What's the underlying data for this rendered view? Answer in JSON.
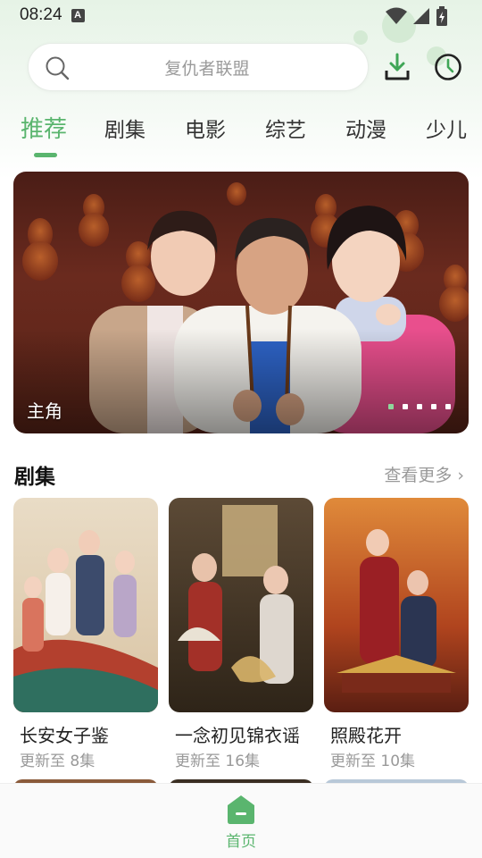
{
  "status_bar": {
    "time": "08:24",
    "notif_badge": "A"
  },
  "search": {
    "placeholder": "复仇者联盟"
  },
  "tabs": [
    {
      "label": "推荐",
      "active": true
    },
    {
      "label": "剧集",
      "active": false
    },
    {
      "label": "电影",
      "active": false
    },
    {
      "label": "综艺",
      "active": false
    },
    {
      "label": "动漫",
      "active": false
    },
    {
      "label": "少儿",
      "active": false
    }
  ],
  "banner": {
    "title": "主角",
    "slide_count": 6,
    "active_slide": 1
  },
  "section": {
    "title": "剧集",
    "more_label": "查看更多 ›",
    "items": [
      {
        "title": "长安女子鉴",
        "subtitle": "更新至 8集"
      },
      {
        "title": "一念初见锦衣谣",
        "subtitle": "更新至 16集"
      },
      {
        "title": "照殿花开",
        "subtitle": "更新至 10集"
      }
    ]
  },
  "bottom_nav": {
    "home_label": "首页"
  },
  "colors": {
    "accent": "#5ab56e",
    "banner_bg": "#5a2418"
  }
}
